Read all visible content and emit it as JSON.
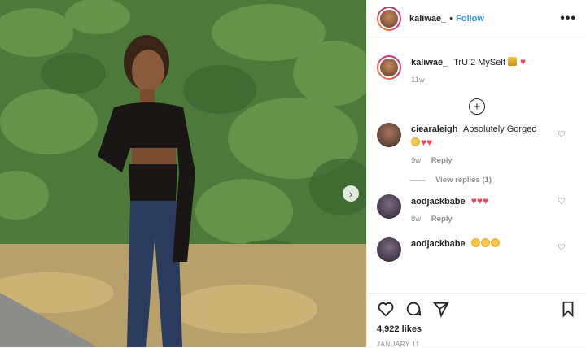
{
  "post": {
    "author": "kaliwae_",
    "follow_label": "Follow",
    "separator": "•",
    "caption": {
      "username": "kaliwae_",
      "text": "TrU 2 MySelf",
      "time": "11w"
    },
    "comments": [
      {
        "username": "ciearaleigh",
        "text": "Absolutely Gorgeo",
        "time": "9w",
        "reply_label": "Reply",
        "view_replies": "View replies (1)"
      },
      {
        "username": "aodjackbabe",
        "text": "",
        "time": "8w",
        "reply_label": "Reply"
      },
      {
        "username": "aodjackbabe",
        "text": ""
      }
    ],
    "likes": "4,922 likes",
    "date": "JANUARY 11"
  },
  "colors": {
    "link_blue": "#3897f0",
    "heart_red": "#ed4956",
    "muted": "#8e8e8e"
  },
  "icons": {
    "more": "more-options-icon",
    "like": "heart-outline-icon",
    "comment": "comment-bubble-icon",
    "share": "paper-plane-icon",
    "save": "bookmark-icon",
    "load_more": "plus-circle-icon",
    "carousel_next": "chevron-right-icon"
  }
}
